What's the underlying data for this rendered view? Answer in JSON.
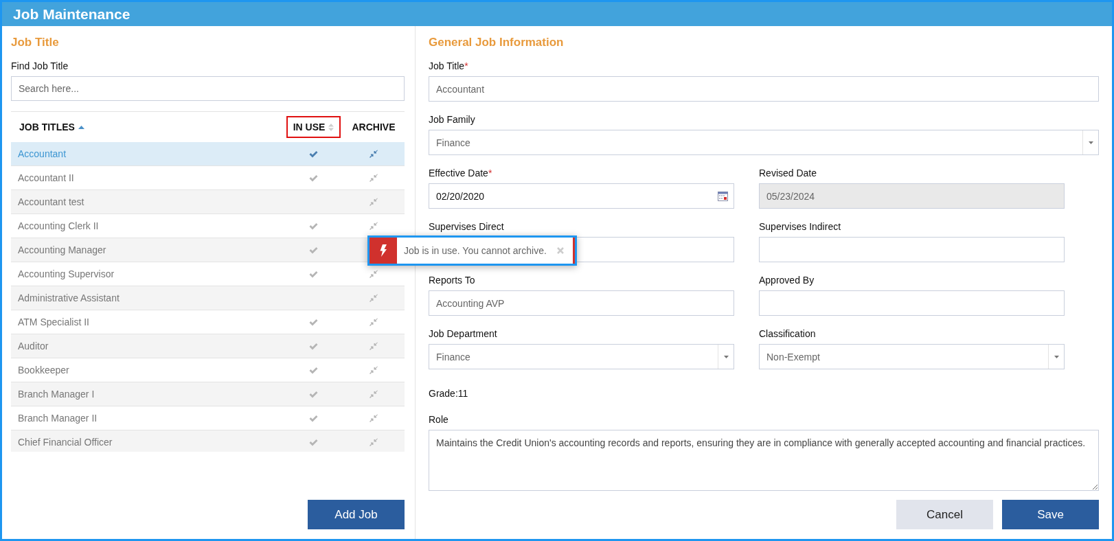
{
  "window": {
    "title": "Job Maintenance"
  },
  "left": {
    "heading": "Job Title",
    "search": {
      "label": "Find Job Title",
      "placeholder": "Search here..."
    },
    "columns": [
      {
        "label": "JOB TITLES",
        "sorted": true,
        "highlighted": false
      },
      {
        "label": "IN USE",
        "sortable": true,
        "sorted": false,
        "highlighted": true
      },
      {
        "label": "ARCHIVE",
        "sortable": false,
        "sorted": false,
        "highlighted": false
      }
    ],
    "rows": [
      {
        "title": "Accountant",
        "in_use": true,
        "selected": true
      },
      {
        "title": "Accountant II",
        "in_use": true,
        "selected": false
      },
      {
        "title": "Accountant test",
        "in_use": false,
        "selected": false
      },
      {
        "title": "Accounting Clerk II",
        "in_use": true,
        "selected": false
      },
      {
        "title": "Accounting Manager",
        "in_use": true,
        "selected": false
      },
      {
        "title": "Accounting Supervisor",
        "in_use": true,
        "selected": false
      },
      {
        "title": "Administrative Assistant",
        "in_use": false,
        "selected": false
      },
      {
        "title": "ATM Specialist II",
        "in_use": true,
        "selected": false
      },
      {
        "title": "Auditor",
        "in_use": true,
        "selected": false
      },
      {
        "title": "Bookkeeper",
        "in_use": true,
        "selected": false
      },
      {
        "title": "Branch Manager I",
        "in_use": true,
        "selected": false
      },
      {
        "title": "Branch Manager II",
        "in_use": true,
        "selected": false
      },
      {
        "title": "Chief Financial Officer",
        "in_use": true,
        "selected": false
      }
    ],
    "add_button": "Add Job"
  },
  "toast": {
    "kind": "error",
    "message": "Job is in use. You cannot archive."
  },
  "form": {
    "heading": "General Job Information",
    "rows": [
      [
        {
          "label": "Job Title",
          "required_mark": "*",
          "kind": "text",
          "value": "Accountant",
          "disabled": false
        }
      ],
      [
        {
          "label": "Job Family",
          "kind": "select",
          "value": "Finance"
        }
      ],
      [
        {
          "label": "Effective Date",
          "required_mark": "*",
          "kind": "date",
          "value": "02/20/2020"
        },
        {
          "label": "Revised Date",
          "kind": "text",
          "value": "05/23/2024",
          "disabled": true
        }
      ],
      [
        {
          "label": "Supervises Direct",
          "kind": "text",
          "disabled": false
        },
        {
          "label": "Supervises Indirect",
          "kind": "text",
          "disabled": false
        }
      ],
      [
        {
          "label": "Reports To",
          "kind": "text",
          "value": "Accounting AVP",
          "disabled": false
        },
        {
          "label": "Approved By",
          "kind": "text",
          "disabled": false
        }
      ],
      [
        {
          "label": "Job Department",
          "kind": "select",
          "value": "Finance"
        },
        {
          "label": "Classification",
          "kind": "select",
          "value": "Non-Exempt"
        }
      ]
    ],
    "grade": "Grade:11",
    "role": {
      "label": "Role",
      "value": "Maintains the Credit Union's accounting records and reports, ensuring they are in compliance with generally accepted accounting and financial practices."
    },
    "buttons": [
      {
        "label": "Cancel",
        "kind": "secondary"
      },
      {
        "label": "Save",
        "kind": "primary"
      }
    ]
  }
}
